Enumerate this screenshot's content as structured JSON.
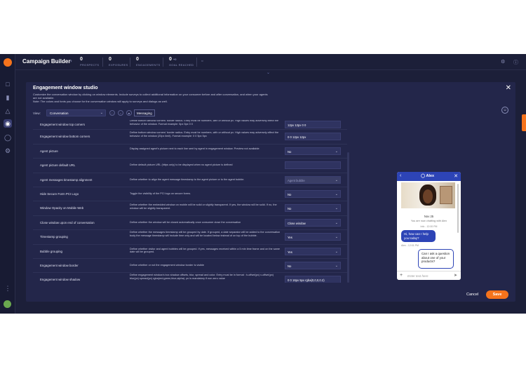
{
  "app": {
    "title": "Campaign Builder",
    "metrics": [
      {
        "num": "0",
        "label": "PROSPECTS",
        "sup": ""
      },
      {
        "num": "0",
        "label": "EXPOSURES",
        "sup": ""
      },
      {
        "num": "0",
        "label": "ENGAGEMENTS",
        "sup": ""
      },
      {
        "num": "0",
        "label": "GOAL REACHED",
        "sup": "+0"
      }
    ]
  },
  "panel": {
    "title": "Engagement window studio",
    "desc1": "Customize the conversation window by clicking on window elements. Include surveys to collect additional information on your consumer before and after conversation, and when your agents are not available.",
    "desc2": "Note: The colors and fonts you choose for the conversation window will apply to surveys and dialogs as well.",
    "view_label": "View:",
    "view_value": "Conversation",
    "messaging_label": "Messaging"
  },
  "rows": [
    {
      "name": "Engagement window top corners",
      "desc": "Define bottom window corners' border radius. Entry must be numbers, with or without px. High values may adversely affect the behavior of the window. Format example: 5px 5px 0 0",
      "value": "12px 12px 0 0",
      "dropdown": false,
      "disabled": false
    },
    {
      "name": "Engagement window bottom corners",
      "desc": "Define bottom window corners' border radius. Entry must be numbers, with or without px. High values may adversely affect the behavior of the window (20px limit). Format example: 0 0 5px 5px",
      "value": "0 0 12px 12px",
      "dropdown": false,
      "disabled": false
    },
    {
      "name": "Agent picture",
      "desc": "Display assigned agent's picture next to each line sent by agent in engagement window. Preview not available",
      "value": "No",
      "dropdown": true,
      "disabled": false
    },
    {
      "name": "Agent picture default URL",
      "desc": "Define default picture URL (https only) to be displayed when no agent picture is defined",
      "value": "",
      "dropdown": false,
      "disabled": false
    },
    {
      "name": "Agent messages timestamp alignment",
      "desc": "Define whether to align the agent message timestamp to the agent picture or to the agent bubble.",
      "value": "Agent bubble",
      "dropdown": true,
      "disabled": true
    },
    {
      "name": "Hide Secure Form PCI Logo",
      "desc": "Toggle the visibility of the PCI logo on secure forms.",
      "value": "No",
      "dropdown": true,
      "disabled": false
    },
    {
      "name": "Window Opacity on Mobile Web",
      "desc": "Define whether the embedded window on mobile will be solid or slightly transparent. If yes, the window will be solid. If no, the window will be slightly transparent.",
      "value": "No",
      "dropdown": true,
      "disabled": false
    },
    {
      "name": "Close window upon end of conversation",
      "desc": "Define whether the window will be closed automatically once consumer close the conversation",
      "value": "Close window",
      "dropdown": true,
      "disabled": false
    },
    {
      "name": "Timestamp grouping",
      "desc": "Define whether the messages timestamp will be grouped by date. If grouped, a date separator will be added to the conversation body the message timestamp will include time only and will be located below instead of on top of the bubble.",
      "value": "Yes",
      "dropdown": true,
      "disabled": false
    },
    {
      "name": "Bubble grouping",
      "desc": "Define whether visitor and agent bubbles will be grouped. If yes, messages received within a 5 min time frame and on the same date will be grouped.",
      "value": "Yes",
      "dropdown": true,
      "disabled": false
    },
    {
      "name": "Engagement window border",
      "desc": "Define whether or not the engagement window border is visible",
      "value": "No",
      "dropdown": true,
      "disabled": false
    },
    {
      "name": "Engagement window shadow",
      "desc": "Define engagement window's box shadow offsets, blur, spread and color. Entry must be in format : h-offset(px) v-offset(px) blur(px) spread(px) rgba(red,green,blue,alpha). px is mandatory if non zero value",
      "value": "0 0 16px 5px rgba(0,0,0,0.2)",
      "dropdown": false,
      "disabled": false
    }
  ],
  "preview": {
    "agent_name": "Alex",
    "date": "Nov 25",
    "system_msg": "You are now chatting with Alex",
    "info": "Info - 12:00 PM",
    "agent_bubble": "Hi, how can I help you today?",
    "agent_meta": "Alex - 12:01 PM",
    "consumer_bubble": "Can I ask a question about one of your products?",
    "input_placeholder": "Enter text here"
  },
  "footer": {
    "cancel": "Cancel",
    "save": "Save"
  }
}
